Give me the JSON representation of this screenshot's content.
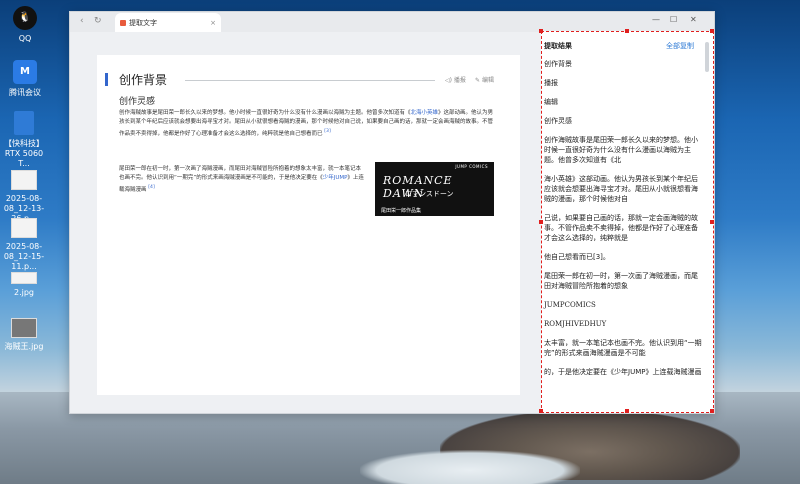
{
  "desktop": {
    "icons": [
      {
        "label": "QQ"
      },
      {
        "label": "腾讯会议"
      },
      {
        "label": "【快科技】RTX 5060 T..."
      },
      {
        "label": "2025-08-08_12-13-26.p..."
      },
      {
        "label": "2025-08-08_12-15-11.p..."
      },
      {
        "label": "2.jpg"
      },
      {
        "label": "海贼王.jpg"
      }
    ]
  },
  "browser": {
    "tab_label": "提取文字",
    "tab_close": "×",
    "controls": {
      "minimize": "—",
      "maximize": "☐",
      "close": "✕"
    },
    "nav": {
      "back": "‹",
      "refresh": "↻"
    }
  },
  "article": {
    "heading": "创作背景",
    "tools": {
      "play": "播报",
      "edit": "编辑"
    },
    "subheading": "创作灵感",
    "p1_a": "创作海贼故事是尾田荣一郎长久以来的梦想。他小时候一直很好奇为什么没有什么漫画以海贼为主题。他曾多次知道有《",
    "p1_link": "北海小英雄",
    "p1_b": "》这部动画。他认为男孩长到某个年纪后应该就会想要出海寻宝才对。尾田从小就很想看海贼的漫画，那个时候他对自己说，如果要自己画的话，那就一定会画海贼的故事。不管作品卖不卖得掉，他都是作好了心理准备才会这么选择的，纯粹就是他自己想看而已",
    "p1_ref": "[3]",
    "p2_a": "尾田荣一郎在初一时，第一次画了海贼漫画，而尾田对海贼冒险所抱着的想象太丰富，就一本笔记本也画不完。他认识到用“一期完”的形式来画海贼漫画是不可能的，于是他决定要在《",
    "p2_link": "少年JUMP",
    "p2_b": "》上连载海贼漫画",
    "p2_ref": "[4]",
    "cover": {
      "top": "JUMP COMICS",
      "title": "ROMANCE DAWN",
      "jp": "ロマンスドーン",
      "bottom": "尾田栄一郎作品集"
    }
  },
  "panel": {
    "title": "提取结果",
    "copy_all": "全部复制",
    "lines": [
      "创作背景",
      "播报",
      "编辑",
      "创作灵感",
      "创作海贼故事是尾田荣一郎长久以来的梦想。他小时候一直很好奇为什么没有什么漫画以海贼为主题。他曾多次知道有《北",
      "海小英雄》这部动画。他认为男孩长到某个年纪后应该就会想要出海寻宝才对。尾田从小就很想看海贼的漫画，那个时候他对自",
      "己说，如果要自己画的话，那就一定会画海贼的故事。不管作品卖不卖得掉，他都是作好了心理准备才会这么选择的，纯粹就是",
      "他自己想看而已[3]。",
      "尾田荣一郎在初一时，第一次画了海贼漫画，而尾田对海贼冒险所抱着的想象",
      "JUMPCOMICS",
      "ROMJHIVEDHUY",
      "太丰富，就一本笔记本也画不完。他认识到用“一期完”的形式来画海贼漫画是不可能",
      "的，于是他决定要在《少年JUMP》上连载海贼漫画"
    ]
  },
  "colors": {
    "accent": "#3366cc",
    "selection": "#e0201f",
    "link": "#2f7bd6"
  }
}
